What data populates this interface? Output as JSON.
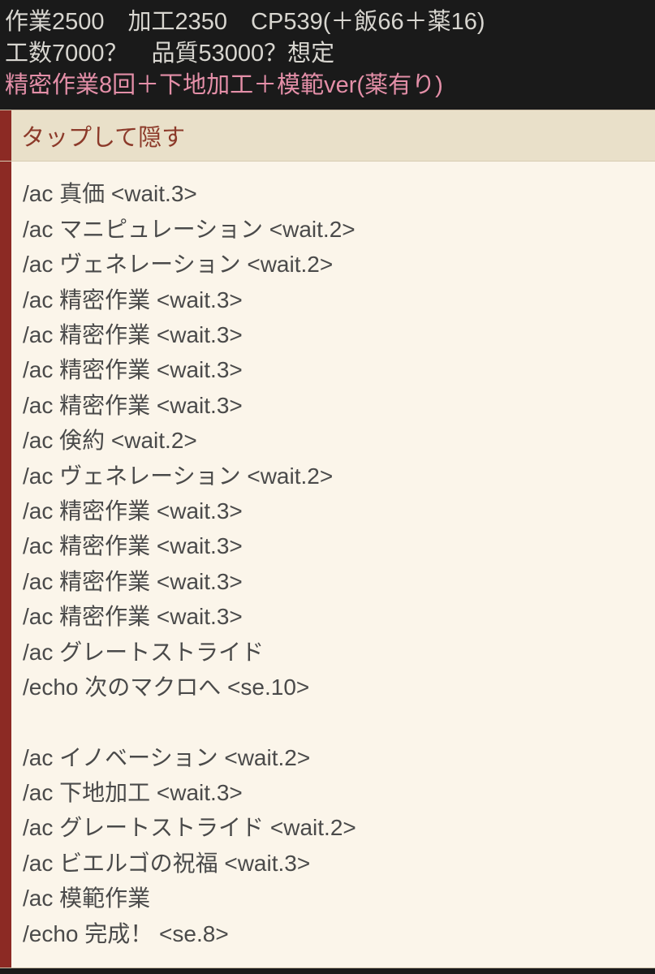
{
  "header": {
    "line1": "作業2500　加工2350　CP539(＋飯66＋薬16)",
    "line2": "工数7000？　品質53000？想定",
    "line3": "精密作業8回＋下地加工＋模範ver(薬有り)"
  },
  "toggle": {
    "label": "タップして隠す"
  },
  "macro": {
    "lines": [
      "/ac 真価 <wait.3>",
      "/ac マニピュレーション <wait.2>",
      "/ac ヴェネレーション <wait.2>",
      "/ac 精密作業 <wait.3>",
      "/ac 精密作業 <wait.3>",
      "/ac 精密作業 <wait.3>",
      "/ac 精密作業 <wait.3>",
      "/ac 倹約 <wait.2>",
      "/ac ヴェネレーション <wait.2>",
      "/ac 精密作業 <wait.3>",
      "/ac 精密作業 <wait.3>",
      "/ac 精密作業 <wait.3>",
      "/ac 精密作業 <wait.3>",
      "/ac グレートストライド",
      "/echo 次のマクロへ <se.10>",
      "",
      "/ac イノベーション <wait.2>",
      "/ac 下地加工 <wait.3>",
      "/ac グレートストライド <wait.2>",
      "/ac ビエルゴの祝福 <wait.3>",
      "/ac 模範作業",
      "/echo 完成！ <se.8>"
    ]
  }
}
